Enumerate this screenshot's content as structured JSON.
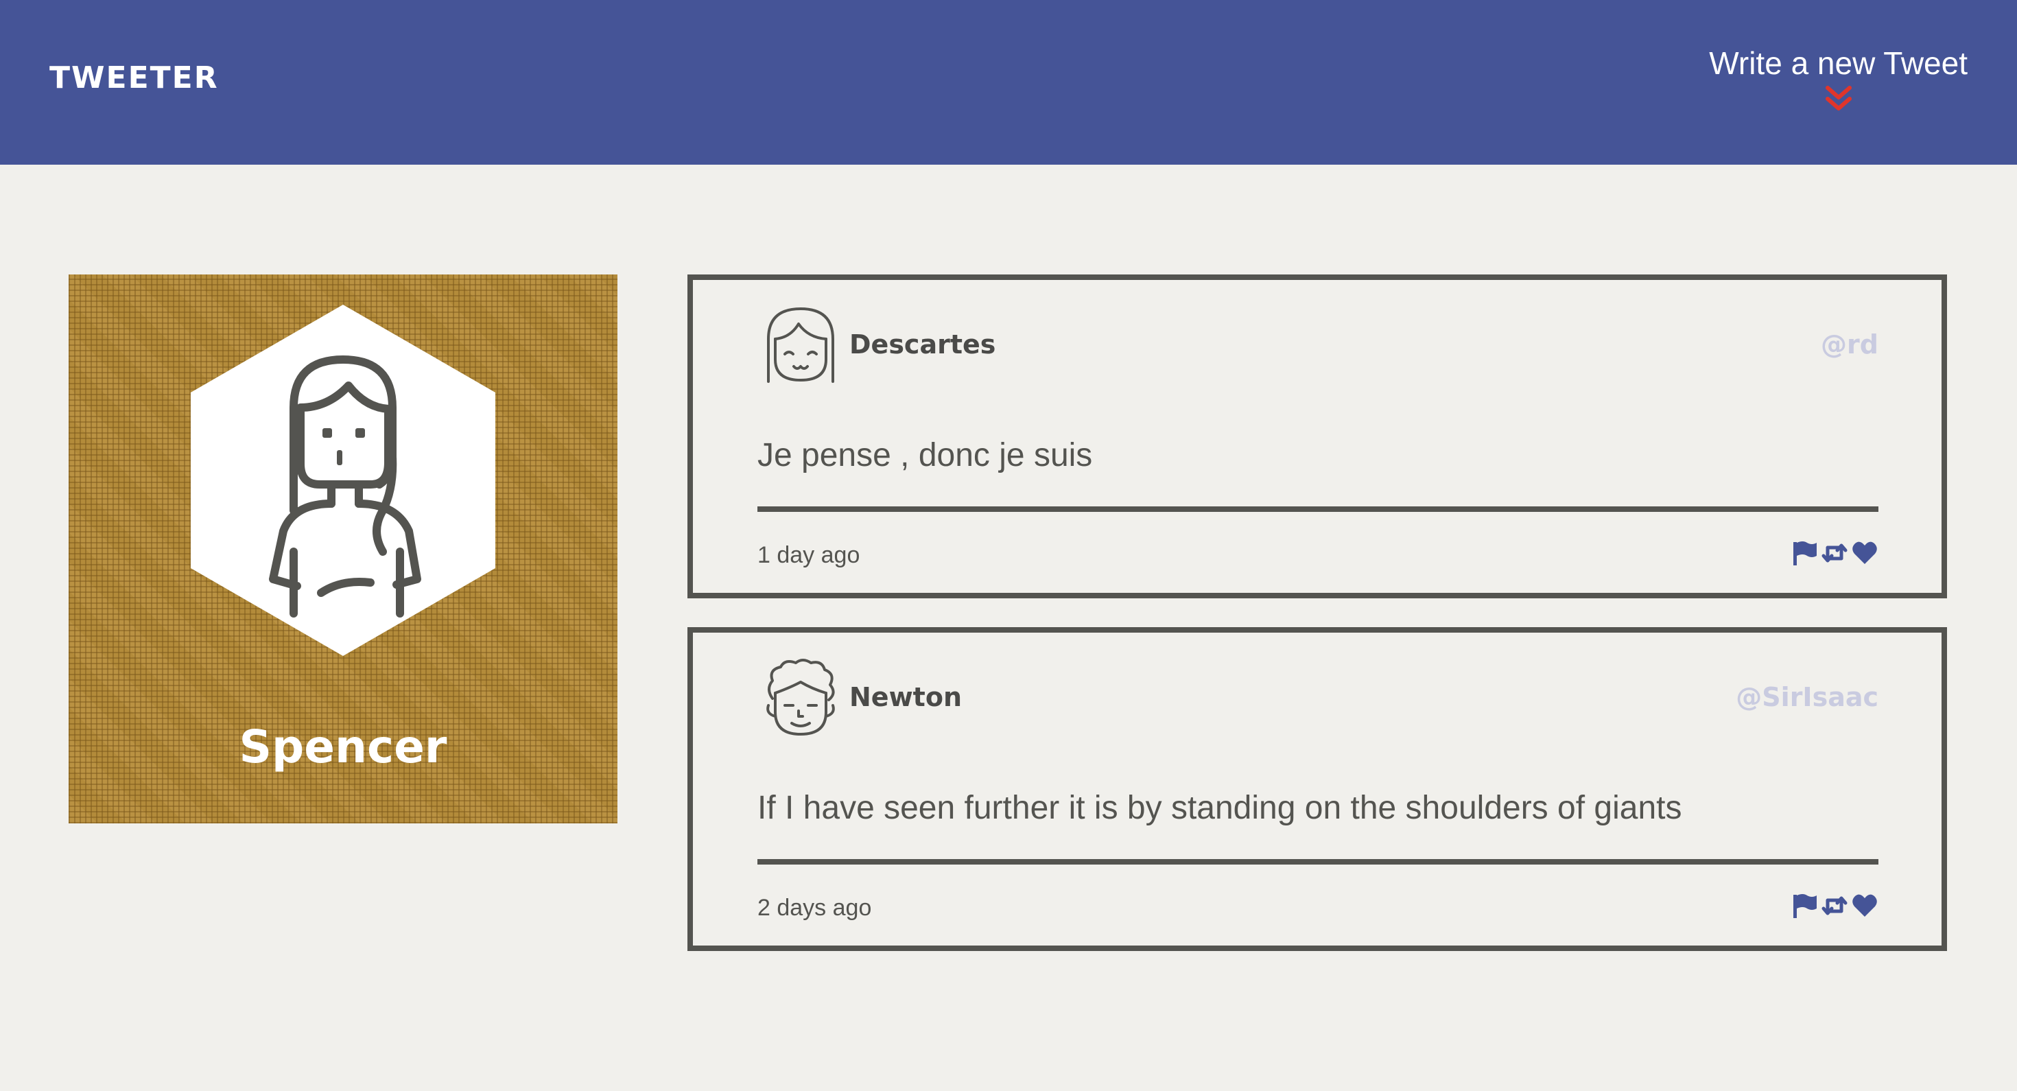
{
  "nav": {
    "brand": "TWEETER",
    "compose_label": "Write a new Tweet",
    "compose_icon": "double-chevron-down-icon",
    "background": "#455497",
    "compose_icon_color": "#e0352b"
  },
  "profile": {
    "name": "Spencer",
    "background": "#b38b3a"
  },
  "tweets": [
    {
      "author": "Descartes",
      "handle": "@rd",
      "content": "Je pense , donc je suis",
      "timestamp": "1 day ago",
      "avatar_icon": "girl-face-icon",
      "actions": [
        "flag-icon",
        "retweet-icon",
        "heart-icon"
      ]
    },
    {
      "author": "Newton",
      "handle": "@SirIsaac",
      "content": "If I have seen further it is by standing on the shoulders of giants",
      "timestamp": "2 days ago",
      "avatar_icon": "curly-hair-face-icon",
      "actions": [
        "flag-icon",
        "retweet-icon",
        "heart-icon"
      ]
    }
  ],
  "colors": {
    "page_background": "#f1f0ec",
    "text": "#545450",
    "handle": "#c9cbe0",
    "action_icon": "#455497"
  }
}
